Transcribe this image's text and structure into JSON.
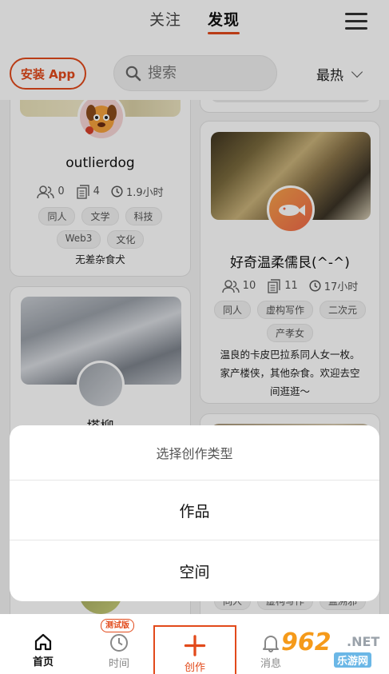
{
  "header": {
    "tabs": [
      "关注",
      "发现"
    ],
    "active_tab": "发现",
    "install_button": "安装 App",
    "search_placeholder": "搜索",
    "sort_value": "最热",
    "accent_color": "#e24a1b"
  },
  "cards": [
    {
      "name": "outlierdog",
      "stats": {
        "followers": "0",
        "works": "4",
        "time": "1.9小时"
      },
      "tags": [
        "同人",
        "文学",
        "科技",
        "Web3",
        "文化"
      ],
      "description": "无差杂食犬"
    },
    {
      "name": "好奇温柔儒艮(^-^)",
      "stats": {
        "followers": "10",
        "works": "11",
        "time": "17小时"
      },
      "tags": [
        "同人",
        "虚构写作",
        "二次元",
        "产孝女"
      ],
      "description": "温良的卡皮巴拉系同人女一枚。家产楼侠，其他杂食。欢迎去空间逛逛～"
    },
    {
      "name": "塔柳"
    }
  ],
  "partial_tags": [
    "同人",
    "虚构写作",
    "盖溯邪"
  ],
  "sheet": {
    "title": "选择创作类型",
    "options": [
      "作品",
      "空间"
    ]
  },
  "bottom_nav": {
    "items": [
      "首页",
      "时间",
      "创作",
      "消息"
    ],
    "beta_badge": "测试版"
  },
  "watermark": {
    "number": "962",
    "suffix": ".NET",
    "site": "乐游网"
  }
}
